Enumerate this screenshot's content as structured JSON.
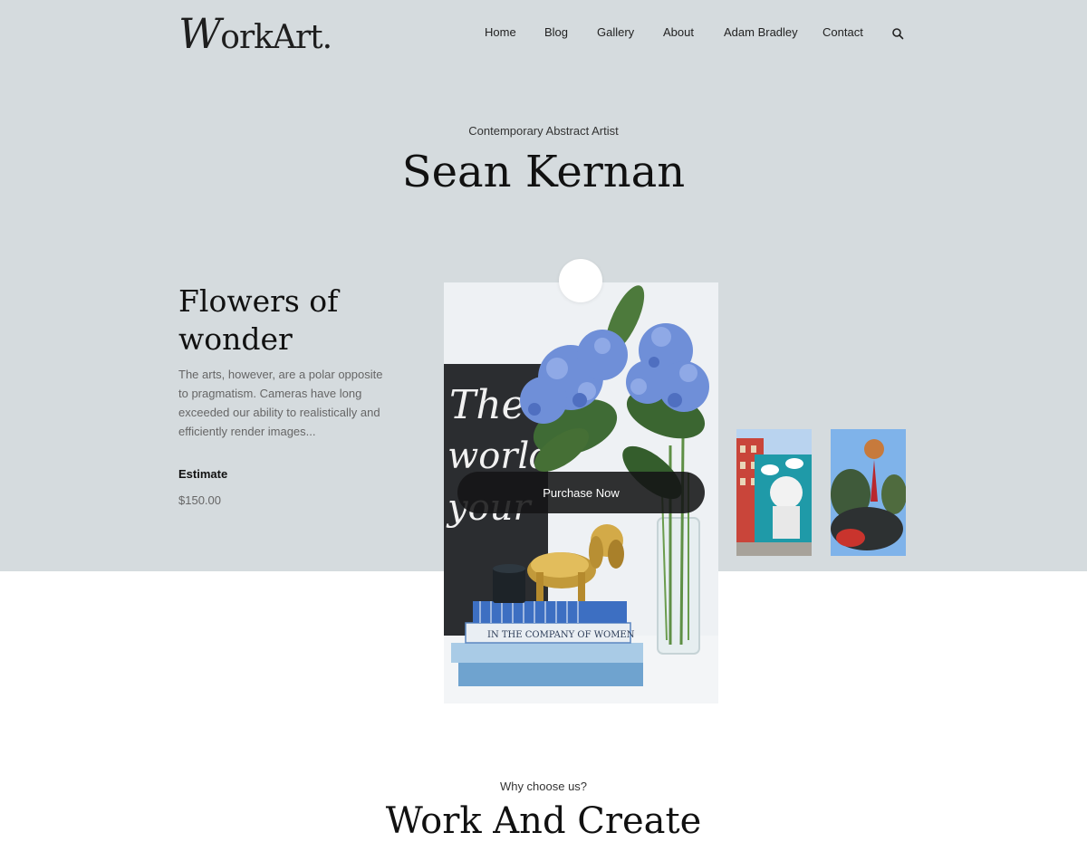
{
  "header": {
    "logo": {
      "initial": "W",
      "rest": "orkArt."
    },
    "nav": [
      {
        "label": "Home"
      },
      {
        "label": "Blog"
      },
      {
        "label": "Gallery"
      },
      {
        "label": "About"
      },
      {
        "label": "Adam Bradley"
      },
      {
        "label": "Contact"
      }
    ],
    "search_icon": "search-icon"
  },
  "hero": {
    "subtitle": "Contemporary Abstract Artist",
    "title": "Sean Kernan"
  },
  "artwork": {
    "title_line1": "Flowers of",
    "title_line2": "wonder",
    "description": "The arts, however, are a polar opposite to pragmatism. Cameras have long exceeded our ability to realistically and efficiently render images...",
    "estimate_label": "Estimate",
    "estimate_value": "$150.00",
    "plus_icon": "plus-icon",
    "purchase_label": "Purchase Now",
    "book_spine_1": "IN THE COMPANY OF WOMEN",
    "chalkboard_text": "The world is your"
  },
  "colors": {
    "hero_bg": "#d5dbde",
    "button_dark": "#141416",
    "hydrangea": "#6f8fd8"
  },
  "why": {
    "label": "Why choose us?",
    "title": "Work And Create"
  }
}
